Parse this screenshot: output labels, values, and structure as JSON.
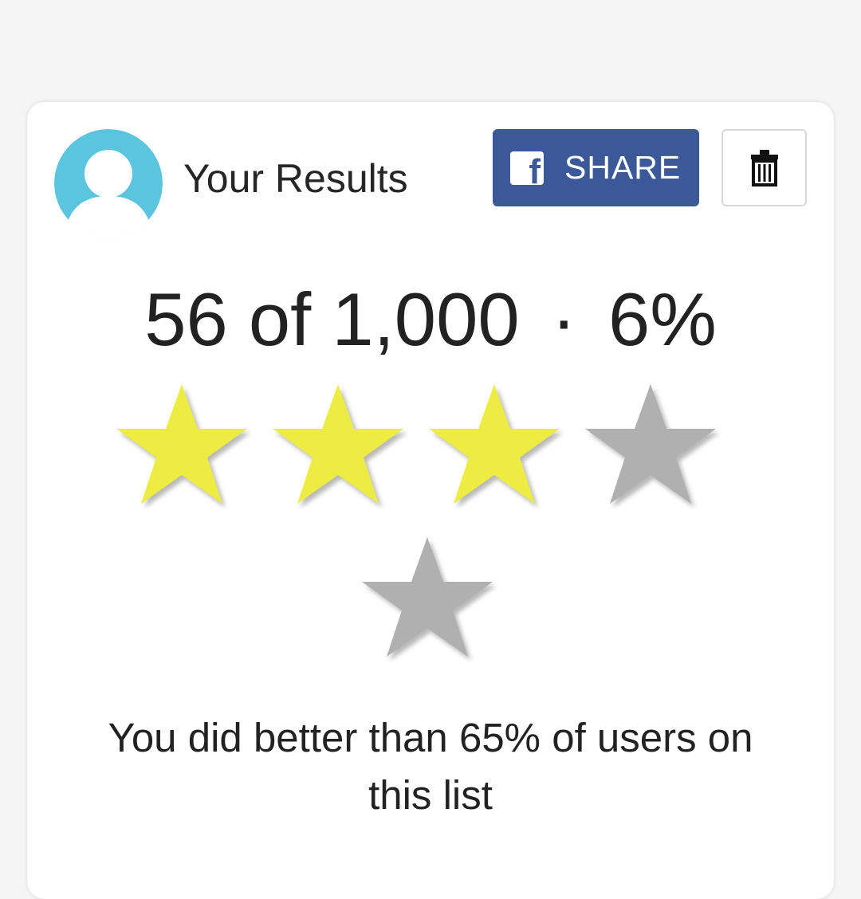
{
  "card": {
    "title": "Your Results",
    "avatar_icon": "user-avatar-icon",
    "share_button": {
      "icon": "facebook-icon",
      "label": "SHARE",
      "color": "#3b5998"
    },
    "delete_button": {
      "icon": "trash-icon"
    }
  },
  "score": {
    "found": "56",
    "of_label": "of",
    "total": "1,000",
    "separator": "·",
    "percent": "6%"
  },
  "rating": {
    "filled": 3,
    "total": 5,
    "filled_color": "#ecec43",
    "empty_color": "#b0b0b0"
  },
  "summary": {
    "text": "You did better than 65% of users on this list"
  },
  "colors": {
    "avatar": "#5bc5e0",
    "background": "#f5f5f5",
    "card": "#ffffff"
  }
}
